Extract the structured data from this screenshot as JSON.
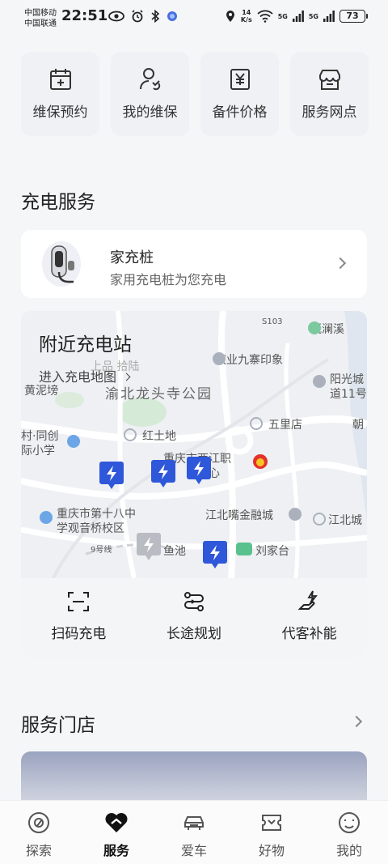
{
  "status_bar": {
    "carrier1": "中国移动",
    "carrier2": "中国联通",
    "time": "22:51",
    "net_speed_value": "14",
    "net_speed_unit": "K/s",
    "signal1": "5G",
    "signal2": "5G",
    "battery": "73"
  },
  "top_services": [
    {
      "label": "维保预约",
      "icon": "calendar-plus-icon"
    },
    {
      "label": "我的维保",
      "icon": "person-wrench-icon"
    },
    {
      "label": "备件价格",
      "icon": "price-tag-yuan-icon"
    },
    {
      "label": "服务网点",
      "icon": "store-icon"
    }
  ],
  "charging": {
    "section_title": "充电服务",
    "home_charger": {
      "title": "家充桩",
      "subtitle": "家用充电桩为您充电"
    },
    "nearby": {
      "title": "附近充电站",
      "map_link": "进入充电地图",
      "map_labels": {
        "l1": "溉澜溪",
        "l2": "庆业九寨印象",
        "l3": "阳光城",
        "l4": "道11号",
        "l5": "渝北龙头寺公园",
        "l6": "黄泥塝",
        "l7": "五里店",
        "l8": "朝",
        "l9": "红土地",
        "l10": "重庆市西江职",
        "l11": "心",
        "l12": "村·同创",
        "l13": "际小学",
        "l14": "重庆市第十八中",
        "l15": "学观音桥校区",
        "l16": "江北嘴金融城",
        "l17": "江北城",
        "l18": "刘家台",
        "l19": "鱼池",
        "l20": "9号线",
        "l21": "S103",
        "l22": "上品 拾陆"
      },
      "actions": [
        {
          "label": "扫码充电",
          "icon": "scan-icon"
        },
        {
          "label": "长途规划",
          "icon": "route-icon"
        },
        {
          "label": "代客补能",
          "icon": "hand-energy-icon"
        }
      ]
    }
  },
  "store": {
    "section_title": "服务门店"
  },
  "bottom_nav": [
    {
      "label": "探索",
      "icon": "compass-icon",
      "active": false
    },
    {
      "label": "服务",
      "icon": "heart-service-icon",
      "active": true
    },
    {
      "label": "爱车",
      "icon": "car-icon",
      "active": false
    },
    {
      "label": "好物",
      "icon": "ticket-icon",
      "active": false
    },
    {
      "label": "我的",
      "icon": "profile-icon",
      "active": false
    }
  ]
}
